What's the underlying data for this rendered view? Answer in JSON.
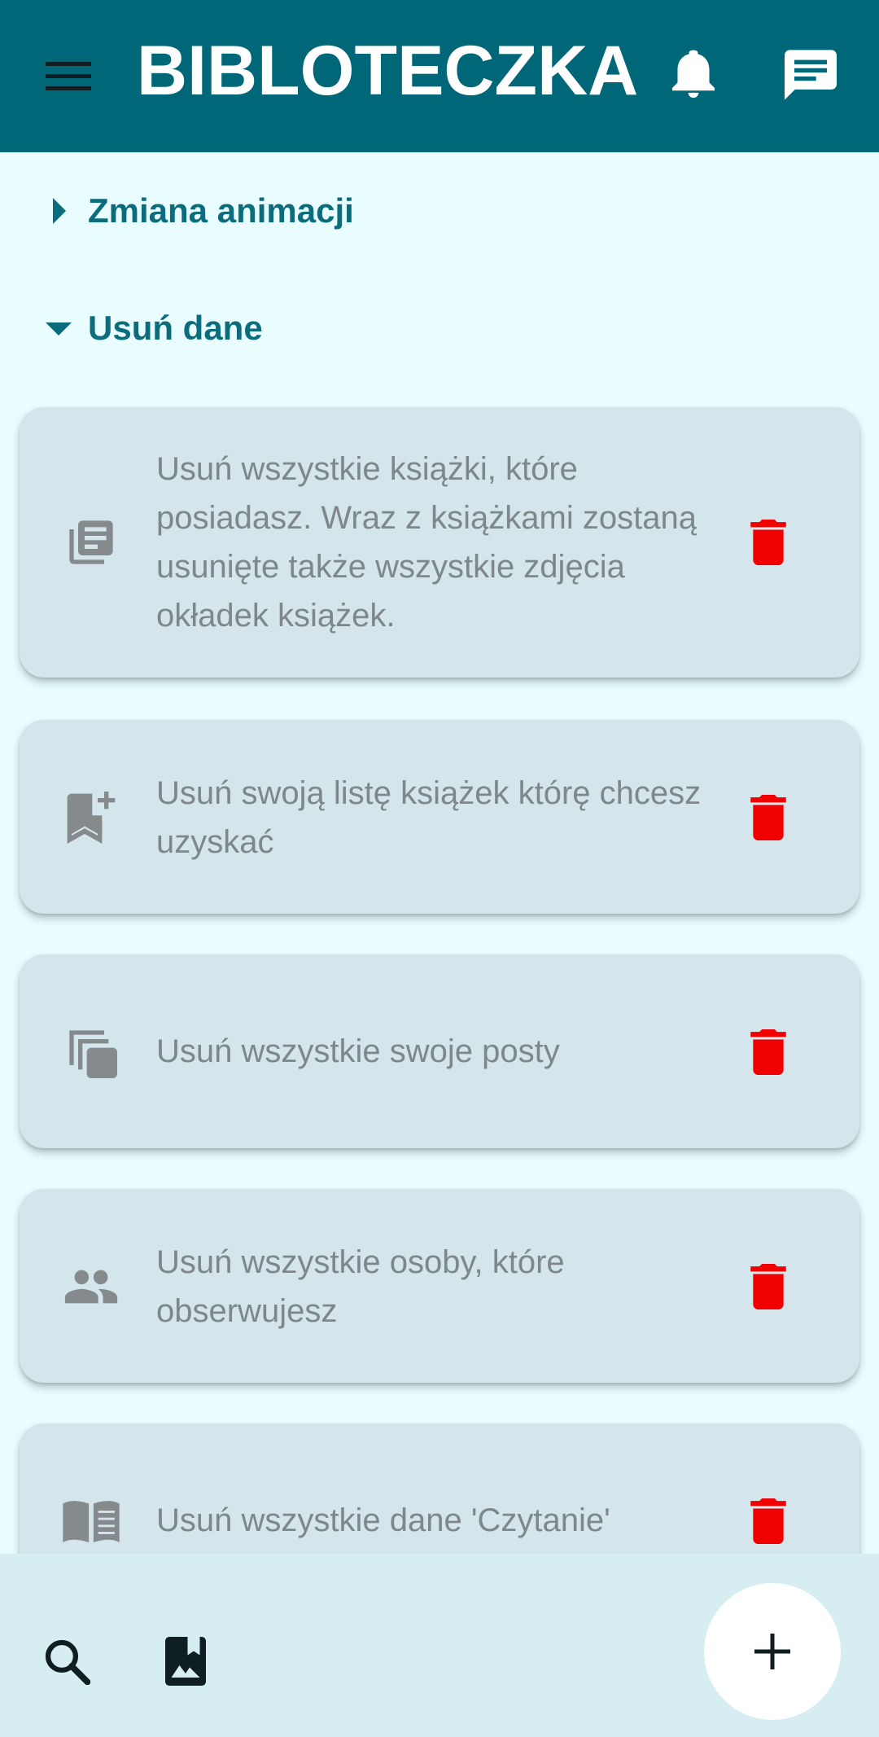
{
  "appbar": {
    "title": "BIBLOTECZKA",
    "icons": {
      "menu": "menu-icon",
      "notifications": "bell-icon",
      "messages": "chat-icon"
    },
    "background": "#006779"
  },
  "sections": [
    {
      "label": "Zmiana animacji",
      "expanded": false
    },
    {
      "label": "Usuń dane",
      "expanded": true
    }
  ],
  "delete_items": [
    {
      "icon": "library-books-icon",
      "text": "Usuń wszystkie książki, które posiadasz. Wraz z książkami zostaną usunięte także wszystkie zdjęcia okładek książek."
    },
    {
      "icon": "bookmark-add-icon",
      "text": "Usuń swoją listę książek którę chcesz uzyskać"
    },
    {
      "icon": "copy-icon",
      "text": "Usuń wszystkie swoje posty"
    },
    {
      "icon": "people-icon",
      "text": "Usuń wszystkie osoby, które obserwujesz"
    },
    {
      "icon": "open-book-icon",
      "text": "Usuń wszystkie dane 'Czytanie'"
    }
  ],
  "bottom_bar": {
    "icons": {
      "search": "search-icon",
      "gallery": "bookmark-image-icon",
      "add": "plus-icon"
    }
  },
  "colors": {
    "accent": "#0b6c7e",
    "card": "#d4e5eb",
    "page_background": "#e9fdff",
    "trash": "#f00000",
    "bottom_bar": "#d6eef1"
  }
}
